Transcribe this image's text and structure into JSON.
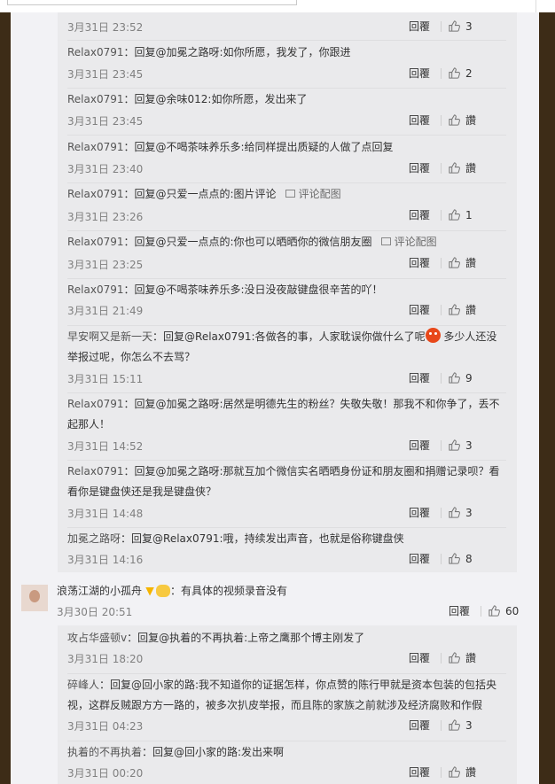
{
  "labels": {
    "reply": "回覆",
    "pic": "评论配图"
  },
  "replies1": [
    {
      "text": "",
      "user": "",
      "time": "3月31日 23:52",
      "likes": "3"
    },
    {
      "user": "Relax0791",
      "text": "：回复@加冕之路呀:如你所愿，我发了，你跟进",
      "time": "3月31日 23:45",
      "likes": "2"
    },
    {
      "user": "Relax0791",
      "text": "：回复@余味012:如你所愿，发出来了",
      "time": "3月31日 23:45",
      "likes": "讚"
    },
    {
      "user": "Relax0791",
      "text": "：回复@不喝茶味养乐多:给同样提出质疑的人做了点回复",
      "time": "3月31日 23:40",
      "likes": "讚"
    },
    {
      "user": "Relax0791",
      "text": "：回复@只爱一点点的:图片评论",
      "time": "3月31日 23:26",
      "likes": "1",
      "pic": true
    },
    {
      "user": "Relax0791",
      "text": "：回复@只爱一点点的:你也可以晒晒你的微信朋友圈",
      "time": "3月31日 23:25",
      "likes": "讚",
      "pic": true
    },
    {
      "user": "Relax0791",
      "text": "：回复@不喝茶味养乐多:没日没夜敲键盘很辛苦的吖！",
      "time": "3月31日 21:49",
      "likes": "讚"
    },
    {
      "user": "早安啊又是新一天",
      "text": "：回复@Relax0791:各做各的事，人家耽误你做什么了呢",
      "text2": "多少人还没举报过呢，你怎么不去骂？",
      "emoji": true,
      "time": "3月31日 15:11",
      "likes": "9"
    },
    {
      "user": "Relax0791",
      "text": "：回复@加冕之路呀:居然是明德先生的粉丝？失敬失敬！那我不和你争了，丢不起那人！",
      "time": "3月31日 14:52",
      "likes": "3"
    },
    {
      "user": "Relax0791",
      "text": "：回复@加冕之路呀:那就互加个微信实名晒晒身份证和朋友圈和捐赠记录呗？看看你是键盘侠还是我是键盘侠？",
      "time": "3月31日 14:48",
      "likes": "3"
    },
    {
      "user": "加冕之路呀",
      "text": "：回复@Relax0791:哦，持续发出声音，也就是俗称键盘侠",
      "time": "3月31日 14:16",
      "likes": "8"
    }
  ],
  "root": {
    "user": "浪荡江湖的小孤舟",
    "text": "：有具体的视频录音没有",
    "time": "3月30日 20:51",
    "likes": "60"
  },
  "replies2": [
    {
      "user": "攻占华盛顿v",
      "text": "：回复@执着的不再执着:上帝之鹰那个博主刚发了",
      "time": "3月31日 18:20",
      "likes": "讚"
    },
    {
      "user": "碎峰人",
      "text": "：回复@回小家的路:我不知道你的证据怎样，你点赞的陈行甲就是资本包装的包括央视，这群反贼跟方方一路的，被多次扒皮举报，而且陈的家族之前就涉及经济腐败和作假",
      "time": "3月31日 04:23",
      "likes": "3"
    },
    {
      "user": "执着的不再执着",
      "text": "：回复@回小家的路:发出来啊",
      "time": "3月31日 00:20",
      "likes": "讚"
    }
  ]
}
